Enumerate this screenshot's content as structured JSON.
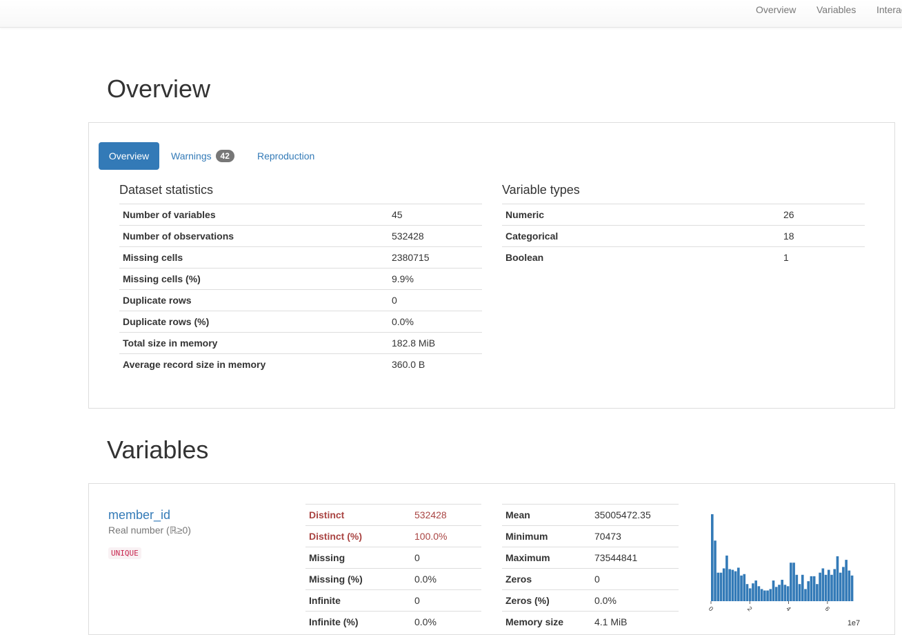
{
  "navbar": {
    "links": [
      "Overview",
      "Variables",
      "Interactions"
    ]
  },
  "overview": {
    "title": "Overview",
    "tabs": {
      "overview": "Overview",
      "warnings": "Warnings",
      "warnings_count": "42",
      "reproduction": "Reproduction"
    },
    "dataset_statistics": {
      "title": "Dataset statistics",
      "rows": [
        {
          "label": "Number of variables",
          "value": "45"
        },
        {
          "label": "Number of observations",
          "value": "532428"
        },
        {
          "label": "Missing cells",
          "value": "2380715"
        },
        {
          "label": "Missing cells (%)",
          "value": "9.9%"
        },
        {
          "label": "Duplicate rows",
          "value": "0"
        },
        {
          "label": "Duplicate rows (%)",
          "value": "0.0%"
        },
        {
          "label": "Total size in memory",
          "value": "182.8 MiB"
        },
        {
          "label": "Average record size in memory",
          "value": "360.0 B"
        }
      ]
    },
    "variable_types": {
      "title": "Variable types",
      "rows": [
        {
          "label": "Numeric",
          "value": "26"
        },
        {
          "label": "Categorical",
          "value": "18"
        },
        {
          "label": "Boolean",
          "value": "1"
        }
      ]
    }
  },
  "variables": {
    "title": "Variables",
    "items": [
      {
        "name": "member_id",
        "type": "Real number (ℝ≥0)",
        "badge": "UNIQUE",
        "stats_left": [
          {
            "label": "Distinct",
            "value": "532428",
            "alert": true
          },
          {
            "label": "Distinct (%)",
            "value": "100.0%",
            "alert": true
          },
          {
            "label": "Missing",
            "value": "0"
          },
          {
            "label": "Missing (%)",
            "value": "0.0%"
          },
          {
            "label": "Infinite",
            "value": "0"
          },
          {
            "label": "Infinite (%)",
            "value": "0.0%"
          }
        ],
        "stats_right": [
          {
            "label": "Mean",
            "value": "35005472.35"
          },
          {
            "label": "Minimum",
            "value": "70473"
          },
          {
            "label": "Maximum",
            "value": "73544841"
          },
          {
            "label": "Zeros",
            "value": "0"
          },
          {
            "label": "Zeros (%)",
            "value": "0.0%"
          },
          {
            "label": "Memory size",
            "value": "4.1 MiB"
          }
        ]
      }
    ]
  },
  "chart_data": {
    "type": "bar",
    "title": "",
    "x_range": [
      70473,
      73544841
    ],
    "x_ticks": [
      "0",
      "2",
      "4",
      "6"
    ],
    "x_offset_label": "1e7",
    "bar_color": "#337ab7",
    "values": [
      122,
      85,
      40,
      40,
      46,
      64,
      45,
      44,
      42,
      47,
      36,
      38,
      24,
      18,
      25,
      29,
      21,
      17,
      15,
      15,
      17,
      29,
      20,
      23,
      30,
      23,
      21,
      54,
      54,
      37,
      24,
      37,
      17,
      28,
      35,
      35,
      24,
      40,
      46,
      37,
      44,
      37,
      45,
      63,
      40,
      48,
      58,
      43,
      36
    ]
  }
}
